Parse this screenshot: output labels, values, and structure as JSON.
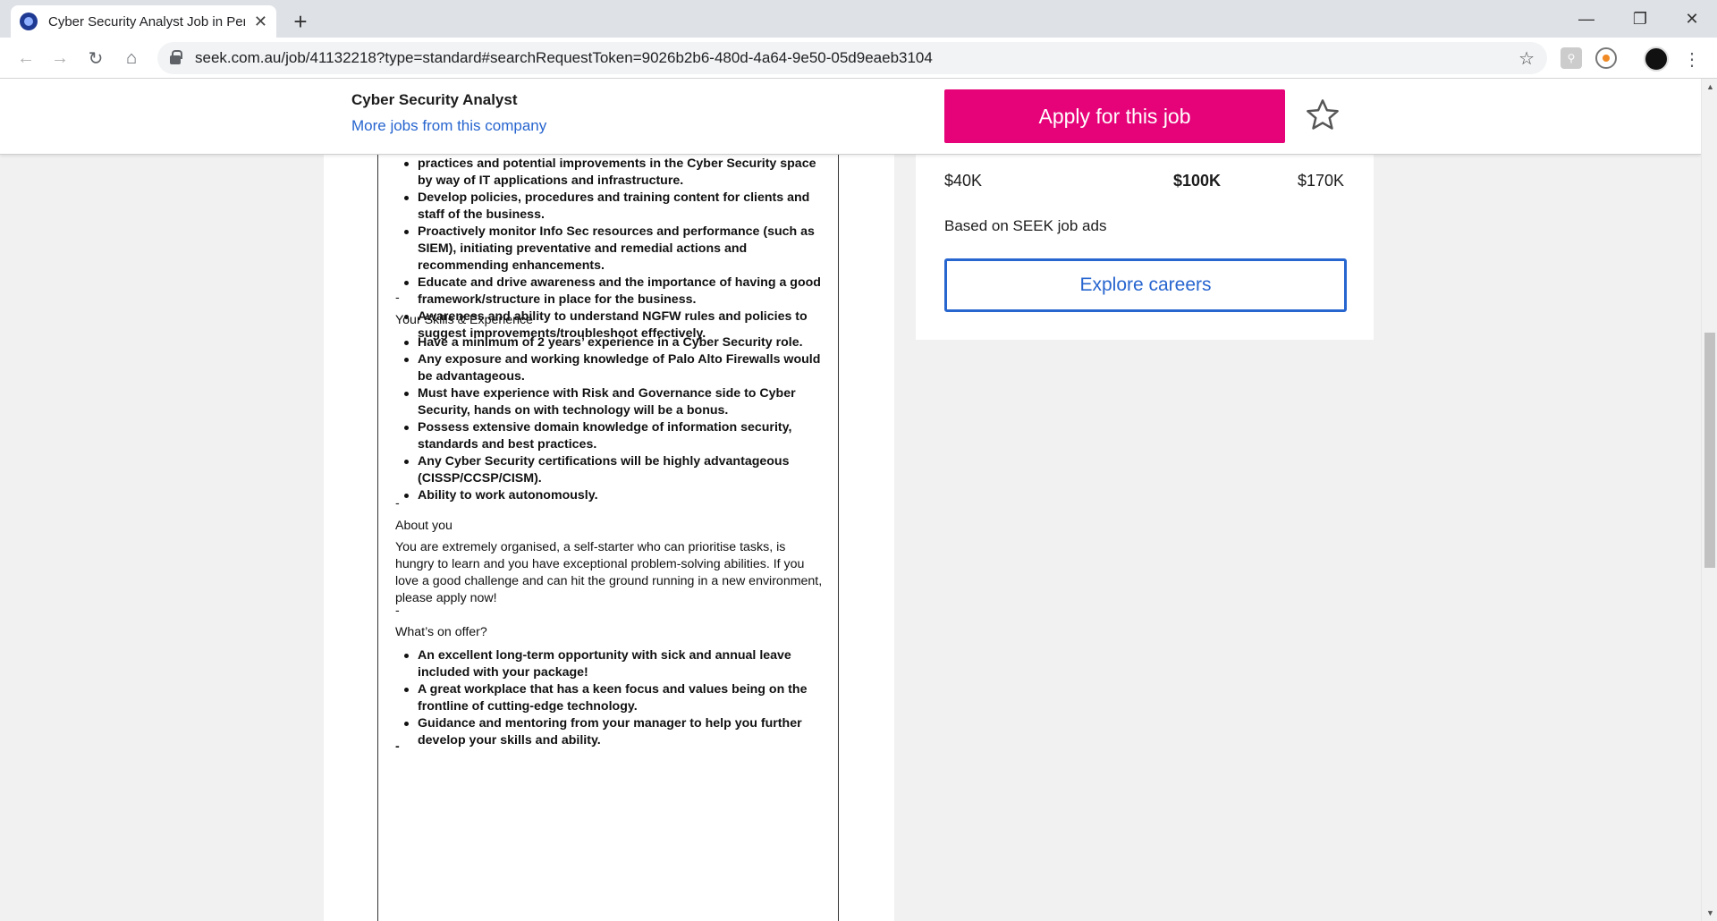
{
  "browser": {
    "tab_title": "Cyber Security Analyst Job in Perth",
    "url": "seek.com.au/job/41132218?type=standard#searchRequestToken=9026b2b6-480d-4a64-9e50-05d9eaeb3104"
  },
  "header": {
    "job_title": "Cyber Security Analyst",
    "more_jobs_link": "More jobs from this company",
    "apply_label": "Apply for this job"
  },
  "salary": {
    "low": "$40K",
    "mid": "$100K",
    "high": "$170K",
    "note": "Based on SEEK job ads",
    "explore_label": "Explore careers",
    "accent_color": "#13aab3"
  },
  "job": {
    "top_items": [
      "practices and potential improvements in the Cyber Security space by way of IT applications and infrastructure.",
      "Develop policies, procedures and training content for clients and staff of the business.",
      "Proactively monitor Info Sec resources and performance (such as SIEM), initiating preventative and remedial actions and recommending enhancements.",
      "Educate and drive awareness and the importance of having a good framework/structure in place for the business.",
      "Awareness and ability to understand NGFW rules and policies to suggest improvements/troubleshoot effectively."
    ],
    "dash": "-",
    "skills_heading": "Your Skills & Experience",
    "skills_items": [
      "Have a minimum of 2 years’ experience in a Cyber Security role.",
      "Any exposure and working knowledge of Palo Alto Firewalls would be advantageous.",
      "Must have experience with Risk and Governance side to Cyber Security, hands on with technology will be a bonus.",
      "Possess extensive domain knowledge of information security, standards and best practices.",
      "Any Cyber Security certifications will be highly advantageous (CISSP/CCSP/CISM).",
      "Ability to work autonomously."
    ],
    "about_heading": "About you",
    "about_text": "You are extremely organised, a self-starter who can prioritise tasks, is hungry to learn and you have exceptional problem-solving abilities. If you love a good challenge and can hit the ground running in a new environment, please apply now!",
    "offer_heading": "What’s on offer?",
    "offer_items": [
      "An excellent long-term opportunity with sick and annual leave included with your package!",
      "A great workplace that has a keen focus and values being on the frontline of cutting-edge technology.",
      "Guidance and mentoring from your manager to help you further develop your skills and ability."
    ]
  },
  "colors": {
    "brand_pink": "#e60278",
    "link_blue": "#2765cf"
  }
}
